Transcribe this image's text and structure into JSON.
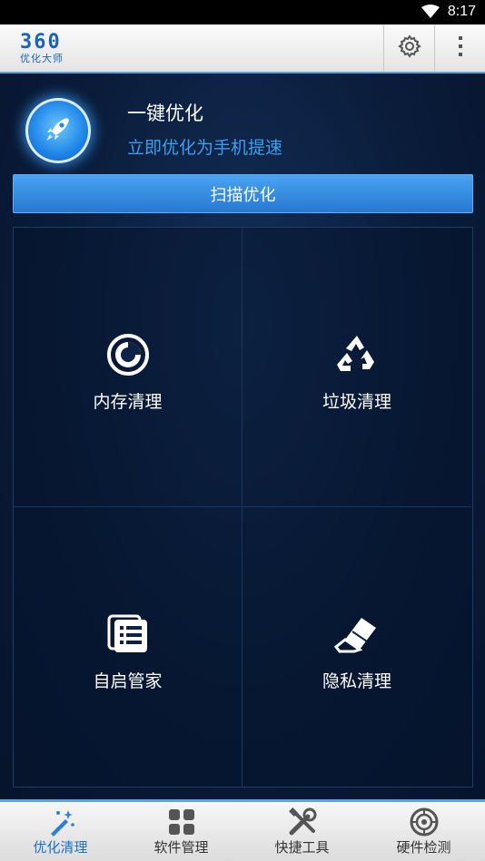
{
  "status_bar": {
    "time": "8:17",
    "wifi_icon": "wifi-icon"
  },
  "header": {
    "logo_number": "360",
    "logo_text": "优化大师",
    "settings_icon": "gear-icon",
    "menu_icon": "overflow-menu-icon"
  },
  "optimize": {
    "icon": "rocket-icon",
    "title": "一键优化",
    "subtitle": "立即优化为手机提速",
    "scan_button": "扫描优化"
  },
  "tiles": [
    {
      "label": "内存清理",
      "icon": "memory-clean-icon"
    },
    {
      "label": "垃圾清理",
      "icon": "recycle-icon"
    },
    {
      "label": "自启管家",
      "icon": "autostart-list-icon"
    },
    {
      "label": "隐私清理",
      "icon": "eraser-icon"
    }
  ],
  "bottom_nav": [
    {
      "label": "优化清理",
      "icon": "magic-wand-icon",
      "active": true
    },
    {
      "label": "软件管理",
      "icon": "apps-grid-icon",
      "active": false
    },
    {
      "label": "快捷工具",
      "icon": "tools-icon",
      "active": false
    },
    {
      "label": "硬件检测",
      "icon": "hardware-scan-icon",
      "active": false
    }
  ],
  "colors": {
    "accent": "#56a6e6",
    "subtitle": "#3a9ff0",
    "button": "#2f86dc",
    "background": "#0a1c3a",
    "active_nav": "#1d6fc7"
  }
}
